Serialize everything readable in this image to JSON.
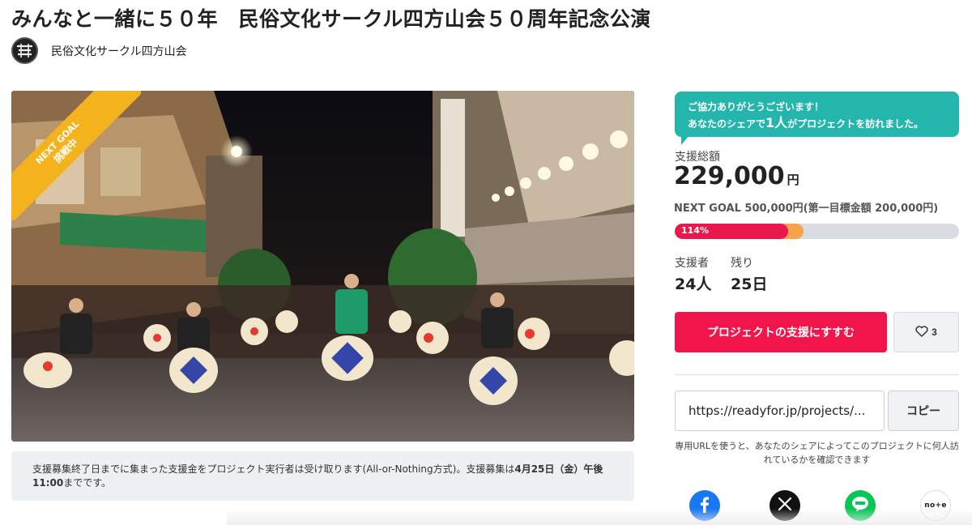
{
  "page": {
    "title": "みんなと一緒に５０年　民俗文化サークル四方山会５０周年記念公演",
    "owner_name": "民俗文化サークル四方山会"
  },
  "hero": {
    "ribbon_line1": "NEXT GOAL",
    "ribbon_line2": "挑戦中",
    "ribbon_color": "#f4b21d"
  },
  "notice": {
    "text_part1": "支援募集終了日までに集まった支援金をプロジェクト実行者は受け取ります(All-or-Nothing方式)。支援募集は",
    "text_bold": "4月25日（金）午後11:00",
    "text_part2": "までです。"
  },
  "bubble": {
    "line1": "ご協力ありがとうございます！",
    "line2_prefix": "あなたのシェアで",
    "line2_count": "1人",
    "line2_suffix": "がプロジェクトを訪れました。",
    "color": "#24b6ad"
  },
  "funding": {
    "total_label": "支援総額",
    "amount": "229,000",
    "unit": "円",
    "next_goal": "NEXT GOAL 500,000円(第一目標金額 200,000円)",
    "progress_label": "114%",
    "progress_fraction_main": 0.4,
    "progress_fraction_next": 0.452,
    "main_color": "#e8184b",
    "next_color": "#f7a34c"
  },
  "stats": {
    "supporters_label": "支援者",
    "supporters_value": "24人",
    "remaining_label": "残り",
    "remaining_value": "25日"
  },
  "actions": {
    "support_label": "プロジェクトの支援にすすむ",
    "favorite_count": "3",
    "support_color": "#f2154b"
  },
  "share": {
    "url_value": "https://readyfor.jp/projects/...",
    "copy_label": "コピー",
    "note": "専用URLを使うと、あなたのシェアによってこのプロジェクトに何人訪れているかを確認できます",
    "icons": [
      "facebook-icon",
      "x-icon",
      "line-icon",
      "note-icon"
    ],
    "note_logo_text": "no+e"
  }
}
